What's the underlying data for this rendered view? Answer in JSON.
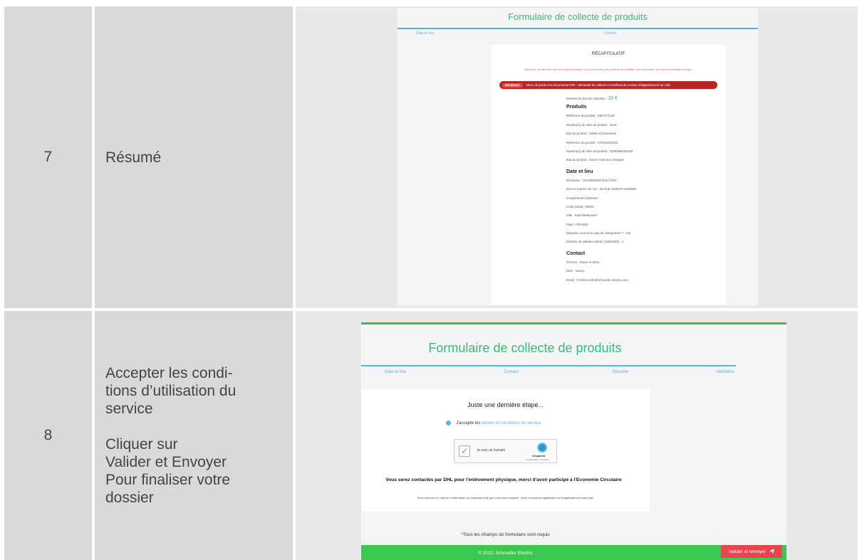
{
  "rows": [
    {
      "number": "7",
      "description": "Résumé",
      "screenshot": {
        "title": "Formulaire de collecte de produits",
        "tabs": [
          "Date et lieu",
          "Contact"
        ],
        "recap_title": "RÉCAPITULATIF",
        "warning": "Attention, vérifiez bien les informations saisies. Il ne vous sera pas possible de modifier votre demande une fois le formulaire envoyé.",
        "important_badge": "IMPORTANT",
        "important_text": "Merci de joindre les documents PDF : demande de collecte et certificat de cession obligatoirement au colis",
        "voucher_label": "Montant du bon de réduction :",
        "voucher_value": "30 €",
        "products_heading": "Produits",
        "products": [
          "Référence du produit : XBTGT2120",
          "Numéro(s) de série du produit : 1234",
          "État du produit : Utilisé et fonctionnel",
          "Référence du produit : ATV61HD11N4",
          "Numéro(s) de série du produit : 1609356GD2345",
          "État du produit : Ouvert mais non énergisé"
        ],
        "date_heading": "Date et lieu",
        "date_lines": [
          "Entreprise : SCHNEIDER ELECTRIC",
          "Nom et numéro de rue : 45 RUE JOSEPH MONIER",
          "Complément d'adresse :",
          "Code postal : 92500",
          "Ville : Rueil-Malmaison",
          "Pays : FRANCE",
          "Disposez vous d'un quai de chargement ? : Oui",
          "Nombre de palettes estimé (1200x800) : 1"
        ],
        "contact_heading": "Contact",
        "contact_lines": [
          "Prénom : Xavier et Elias",
          "Nom : xxxxxx",
          "Email : fr-lehive-colis@schneider-electric.com"
        ]
      }
    },
    {
      "number": "8",
      "description": "Accepter les condi-\ntions d’utilisation du\nservice\n\nCliquer sur\nValider et Envoyer\nPour finaliser votre\ndossier",
      "screenshot": {
        "title": "Formulaire de collecte de produits",
        "tabs": [
          "Date et lieu",
          "Contact",
          "Résumé",
          "Validation"
        ],
        "heading": "Juste une dernière étape...",
        "accept_prefix": "J'accepte les",
        "accept_link": "termes et conditions du service.",
        "captcha_label": "Je suis un humain",
        "captcha_brand": "hCaptcha",
        "captcha_privacy": "Confidentialité - Conditions",
        "strong_text": "Vous serez contactés par DHL pour l'enlèvement physique, merci d'avoir participé à l'Economie Circulaire",
        "small_text": "Vous recevrez un mail de confirmation sur l'adresse mail que vous avez indiquée. Vous y trouverez également un récapitulatif au format pdf.",
        "required_note": "*Tous les champs du formulaire sont requis",
        "submit_label": "Valider et envoyer",
        "footer_text": "© 2022, Schneider Electric"
      }
    }
  ],
  "colors": {
    "cell_gray": "#d9d9d9",
    "brand_green": "#3cb878",
    "accent_blue": "#5ab4dc",
    "important_red": "#b52626",
    "button_red": "#e8454f",
    "footer_green": "#3cc850"
  }
}
